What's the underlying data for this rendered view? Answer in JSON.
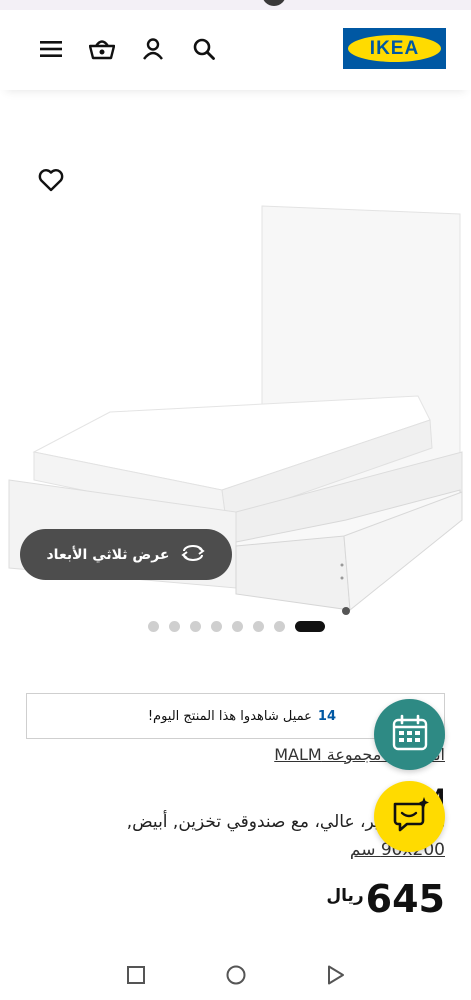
{
  "header": {
    "logo_text": "IKEA",
    "brand_colors": {
      "blue": "#0058a3",
      "yellow": "#ffdb00"
    },
    "icons": [
      "menu-icon",
      "basket-icon",
      "account-icon",
      "search-icon"
    ]
  },
  "gallery": {
    "view_3d_label": "عرض ثلاثي الأبعاد",
    "dot_count": 8,
    "active_index": 0
  },
  "viewers": {
    "count": "14",
    "text": "عميل شاهدوا هذا المنتج اليوم!"
  },
  "product": {
    "collection_link": "انظر إلى مجموعة MALM",
    "name": "M",
    "description": "هيكل سرير، عالي، مع صندوقي تخزين, أبيض,",
    "size": "90x200 سم",
    "price_amount": "645",
    "currency": "ريال"
  },
  "floating": {
    "calendar_icon": "calendar-icon",
    "chat_icon": "chat-sparkle-icon",
    "calendar_color": "#2e8a84",
    "chat_color": "#ffdb00"
  },
  "system_nav": [
    "square-icon",
    "circle-icon",
    "triangle-back-icon"
  ]
}
